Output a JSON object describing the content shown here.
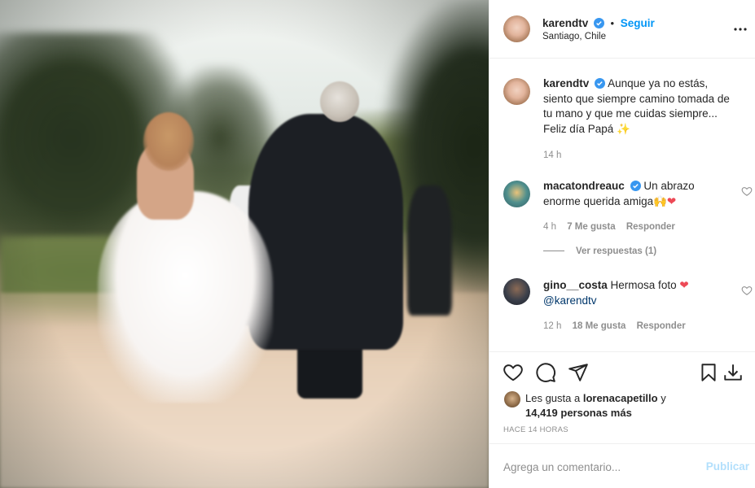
{
  "post": {
    "author": "karendtv",
    "follow_label": "Seguir",
    "separator": "•",
    "location": "Santiago, Chile",
    "more_label": "•••",
    "caption": {
      "author": "karendtv",
      "text": "Aunque ya no estás, siento que siempre camino tomada de tu mano y que me cuidas siempre... Feliz día Papá",
      "emoji": "✨",
      "time": "14 h"
    }
  },
  "comments": [
    {
      "author": "macatondreauc",
      "text": "Un abrazo enorme querida amiga",
      "emoji": "🙌❤",
      "time": "4 h",
      "likes": "7 Me gusta",
      "reply_label": "Responder"
    },
    {
      "author": "gino__costa",
      "text": "Hermosa foto",
      "emoji": "❤",
      "mention": "@karendtv",
      "time": "12 h",
      "likes": "18 Me gusta",
      "reply_label": "Responder"
    }
  ],
  "view_replies": "Ver respuestas (1)",
  "likes": {
    "prefix": "Les gusta a",
    "user": "lorenacapetillo",
    "joiner": "y",
    "count": "14,419 personas más"
  },
  "time_ago": "HACE 14 HORAS",
  "add_comment": {
    "placeholder": "Agrega un comentario...",
    "post_label": "Publicar"
  },
  "colors": {
    "accent": "#0095f6",
    "muted": "#8e8e8e",
    "text": "#262626",
    "post_disabled": "#b2dffc",
    "like_heart": "#ed4956"
  },
  "icons": [
    "verified-badge-icon",
    "heart-icon",
    "comment-icon",
    "share-icon",
    "bookmark-icon",
    "download-icon",
    "more-options-icon"
  ]
}
